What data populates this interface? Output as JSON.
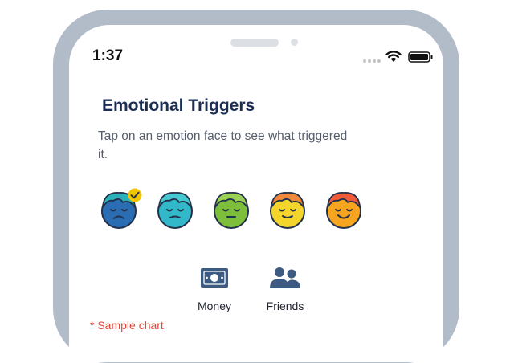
{
  "status_bar": {
    "time": "1:37",
    "icons": [
      "signal-dots-icon",
      "wifi-icon",
      "battery-icon"
    ]
  },
  "screen": {
    "title": "Emotional Triggers",
    "subtitle": "Tap on an emotion face to see what triggered it."
  },
  "faces": [
    {
      "name": "very-sad",
      "color": "#2a6db3",
      "hair": "#2ab0b8",
      "selected": true
    },
    {
      "name": "sad",
      "color": "#33b8c9",
      "hair": "#45c8cf",
      "selected": false
    },
    {
      "name": "neutral",
      "color": "#7dbf3b",
      "hair": "#9ad155",
      "selected": false
    },
    {
      "name": "content",
      "color": "#f4d52b",
      "hair": "#f08a3a",
      "selected": false
    },
    {
      "name": "happy",
      "color": "#f7a51e",
      "hair": "#ef5a3a",
      "selected": false
    }
  ],
  "categories": [
    {
      "label": "Money",
      "icon": "money-icon"
    },
    {
      "label": "Friends",
      "icon": "friends-icon"
    }
  ],
  "note": "* Sample chart",
  "colors": {
    "title": "#1b2d52",
    "note": "#e0483b",
    "frame": "#b2bcc8",
    "check": "#f2c500"
  }
}
